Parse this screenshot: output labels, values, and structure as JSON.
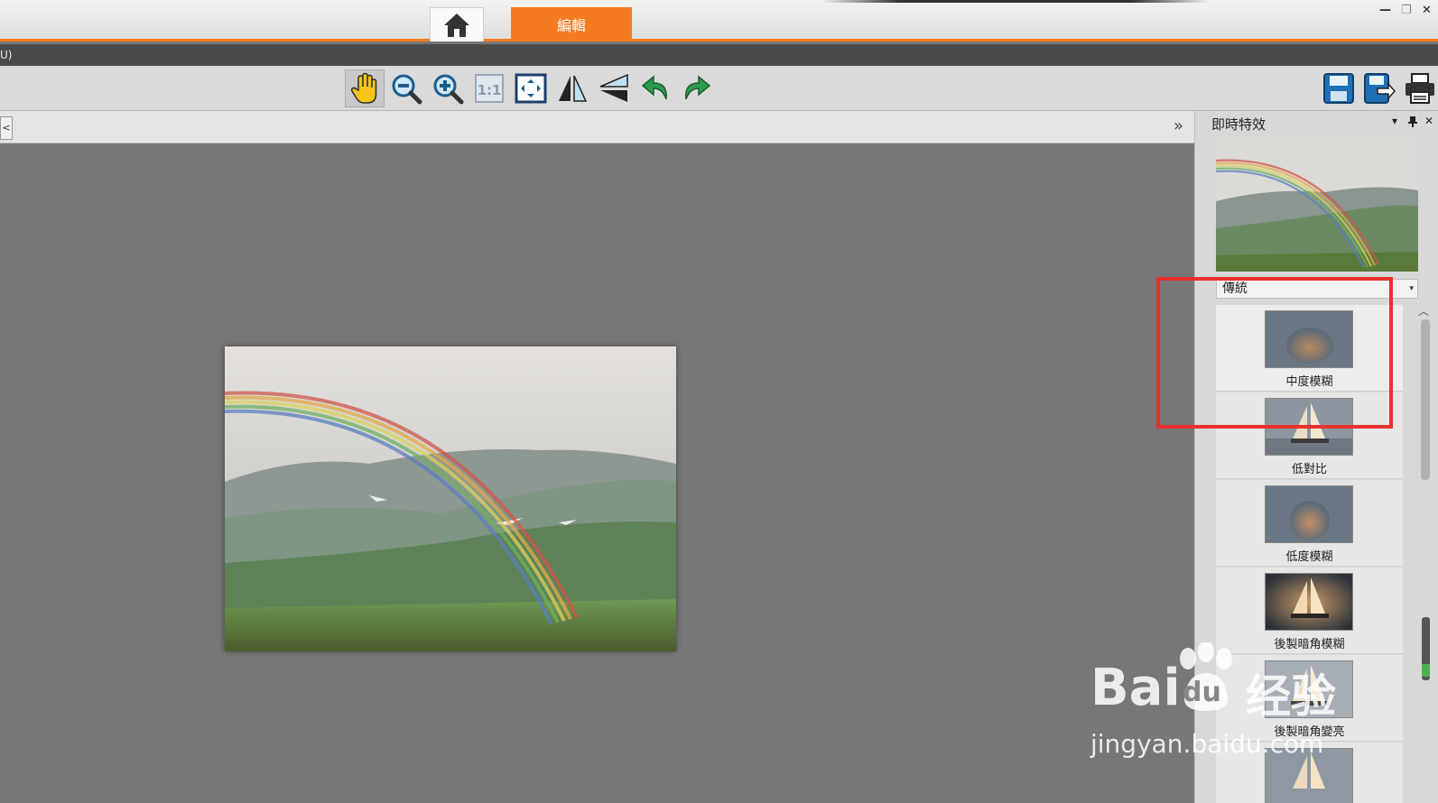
{
  "titlebar": {
    "home_tab": "home",
    "edit_tab": "編輯",
    "minimize": "—",
    "restore": "❐",
    "close": "✕"
  },
  "menustrip": {
    "text": "U)"
  },
  "toolbar": {
    "tools": [
      "hand-tool",
      "zoom-out",
      "zoom-in",
      "actual-size",
      "fit-to-window",
      "flip-horizontal",
      "flip-vertical",
      "rotate-left",
      "rotate-right"
    ],
    "active_tool": "hand-tool",
    "right_tools": [
      "save",
      "save-as",
      "print"
    ]
  },
  "strip2": {
    "left_glyph": "<",
    "right_glyph": "»"
  },
  "panel": {
    "title": "即時特效",
    "ctl_dropdown": "▾",
    "ctl_pin": "📌",
    "ctl_close": "✕",
    "preset_dropdown": "傳統",
    "effects": [
      {
        "label": "中度模糊",
        "thumb": "blur"
      },
      {
        "label": "低對比",
        "thumb": "sailboat"
      },
      {
        "label": "低度模糊",
        "thumb": "blur"
      },
      {
        "label": "後製暗角模糊",
        "thumb": "sailboat-dark"
      },
      {
        "label": "後製暗角變亮",
        "thumb": "sailboat"
      },
      {
        "label": "",
        "thumb": "sailboat"
      }
    ]
  },
  "watermark": {
    "brand": "Bai",
    "brand2": "du",
    "cn": "经验",
    "url": "jingyan.baidu.com"
  },
  "colors": {
    "accent": "#f47b20",
    "highlight_box": "#e8312f",
    "canvas_bg": "#777777"
  }
}
